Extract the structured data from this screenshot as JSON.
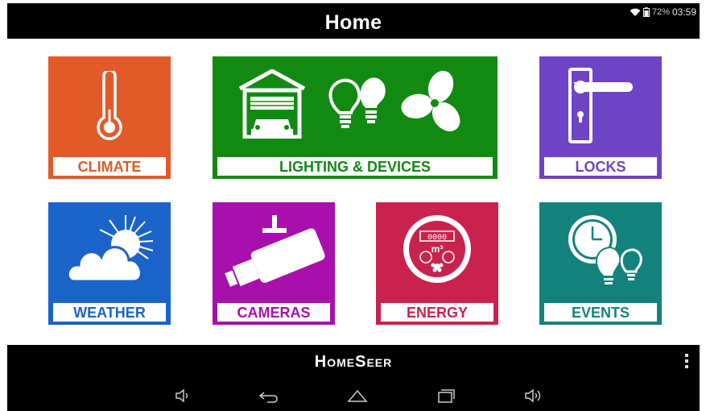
{
  "header": {
    "title": "Home"
  },
  "status_bar": {
    "battery_percent": "72%",
    "time": "03:59"
  },
  "tiles": [
    {
      "label": "CLIMATE",
      "color": "#e35a2a",
      "icon": "thermometer-icon"
    },
    {
      "label": "LIGHTING & DEVICES",
      "color": "#128a12",
      "icon": "garage-bulbs-fan-icon"
    },
    {
      "label": "LOCKS",
      "color": "#6f44c4",
      "icon": "door-handle-icon"
    },
    {
      "label": "WEATHER",
      "color": "#1a63c8",
      "icon": "sun-cloud-icon"
    },
    {
      "label": "CAMERAS",
      "color": "#a80fac",
      "icon": "security-camera-icon"
    },
    {
      "label": "ENERGY",
      "color": "#c9224e",
      "icon": "meter-icon"
    },
    {
      "label": "EVENTS",
      "color": "#13827c",
      "icon": "clock-bulbs-icon"
    }
  ],
  "brand": {
    "name": "HomeSeer"
  },
  "meter": {
    "digits": "0000",
    "unit": "m³"
  },
  "nav": {
    "icons": [
      "volume-down-icon",
      "back-icon",
      "home-icon",
      "recents-icon",
      "volume-up-icon"
    ]
  }
}
